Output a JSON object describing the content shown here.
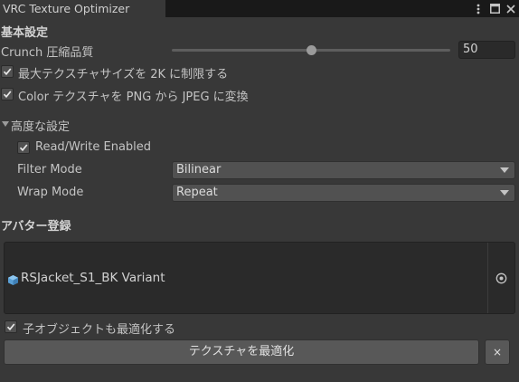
{
  "tab": {
    "title": "VRC Texture Optimizer"
  },
  "window_icons": [
    "more-vert-icon",
    "maximize-icon",
    "close-icon"
  ],
  "basic": {
    "title": "基本設定",
    "crunch_label": "Crunch 圧縮品質",
    "crunch_value": "50",
    "crunch_min": 0,
    "crunch_max": 100,
    "limit_label": "最大テクスチャサイズを 2K に制限する",
    "limit_checked": true,
    "color_label": "Color テクスチャを PNG から JPEG に変換",
    "color_checked": true
  },
  "advanced": {
    "title": "高度な設定",
    "expanded": true,
    "readwrite_label": "Read/Write Enabled",
    "readwrite_checked": true,
    "filter_label": "Filter Mode",
    "filter_value": "Bilinear",
    "wrap_label": "Wrap Mode",
    "wrap_value": "Repeat"
  },
  "avatar": {
    "title": "アバター登録",
    "object_name": "RSJacket_S1_BK Variant",
    "object_icon": "prefab-variant-icon",
    "children_label": "子オブジェクトも最適化する",
    "children_checked": true,
    "optimize_button": "テクスチャを最適化",
    "clear_button": "×"
  },
  "colors": {
    "panel_bg": "#383838",
    "tab_bar_bg": "#191919",
    "field_bg": "#2a2a2a",
    "button_bg": "#585858"
  }
}
